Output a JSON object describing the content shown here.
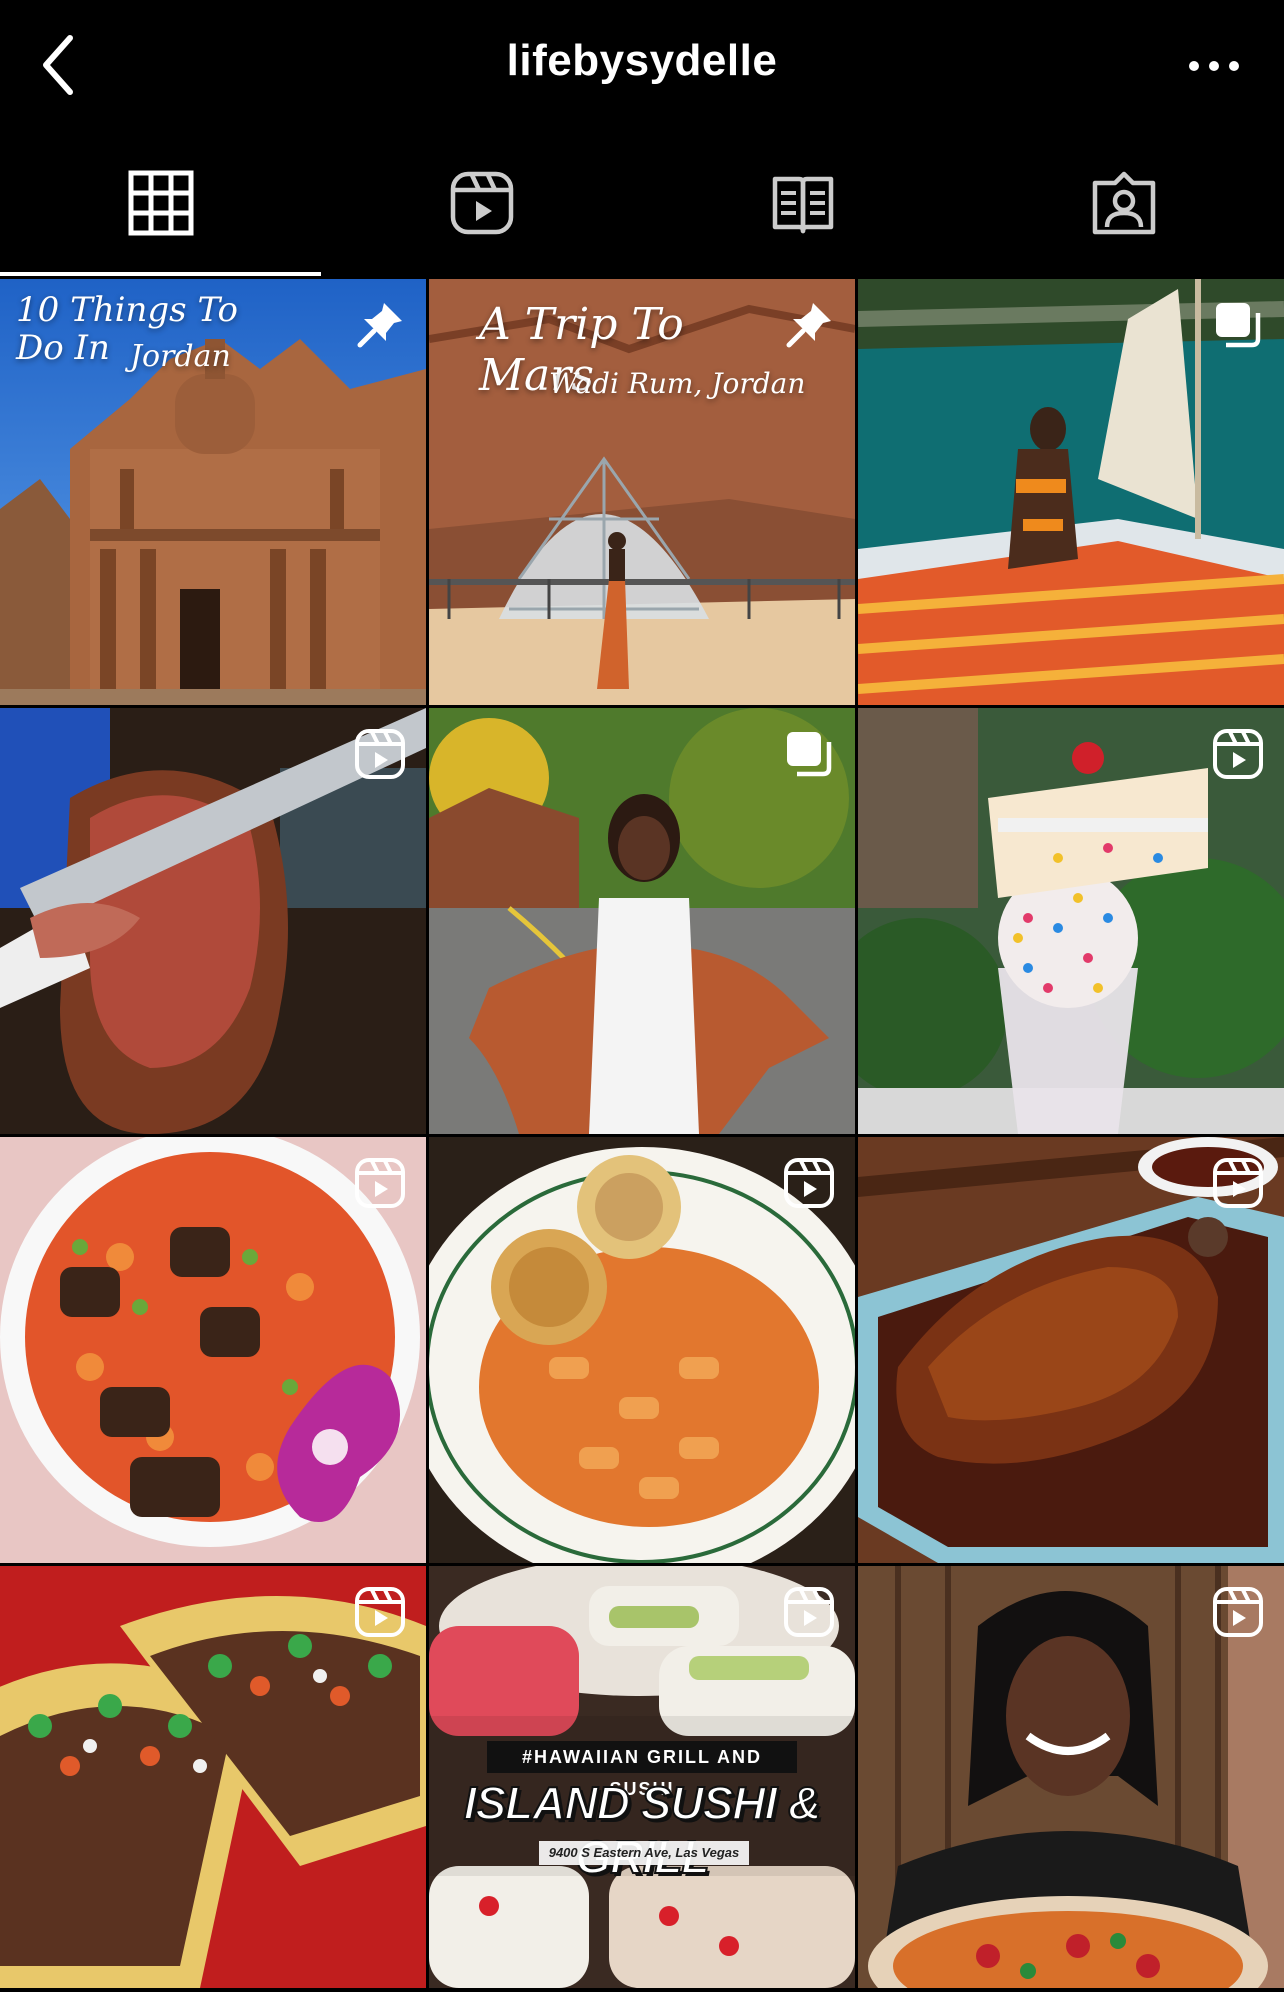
{
  "header": {
    "username": "lifebysydelle"
  },
  "tabs": [
    {
      "id": "grid",
      "icon": "grid-icon",
      "selected": true
    },
    {
      "id": "reels",
      "icon": "reels-icon",
      "selected": false
    },
    {
      "id": "guides",
      "icon": "guide-book-icon",
      "selected": false
    },
    {
      "id": "tagged",
      "icon": "tagged-person-icon",
      "selected": false
    }
  ],
  "posts": [
    {
      "badge": "pin-icon",
      "overlay": {
        "line1": "10 Things To Do In",
        "line2": "Jordan"
      }
    },
    {
      "badge": "pin-icon",
      "overlay": {
        "line1": "A Trip To Mars",
        "line2": "Wadi Rum, Jordan"
      }
    },
    {
      "badge": "carousel-icon"
    },
    {
      "badge": "reel-icon"
    },
    {
      "badge": "carousel-icon"
    },
    {
      "badge": "reel-icon"
    },
    {
      "badge": "reel-icon"
    },
    {
      "badge": "reel-icon"
    },
    {
      "badge": "reel-icon"
    },
    {
      "badge": "reel-icon"
    },
    {
      "badge": "reel-icon",
      "overlay": {
        "tag": "#HAWAIIAN GRILL AND SUSHI",
        "name": "ISLAND SUSHI & GRILL",
        "address": "9400 S Eastern Ave, Las Vegas"
      }
    },
    {
      "badge": "reel-icon"
    }
  ],
  "colors": {
    "background": "#000000",
    "text": "#ffffff"
  }
}
